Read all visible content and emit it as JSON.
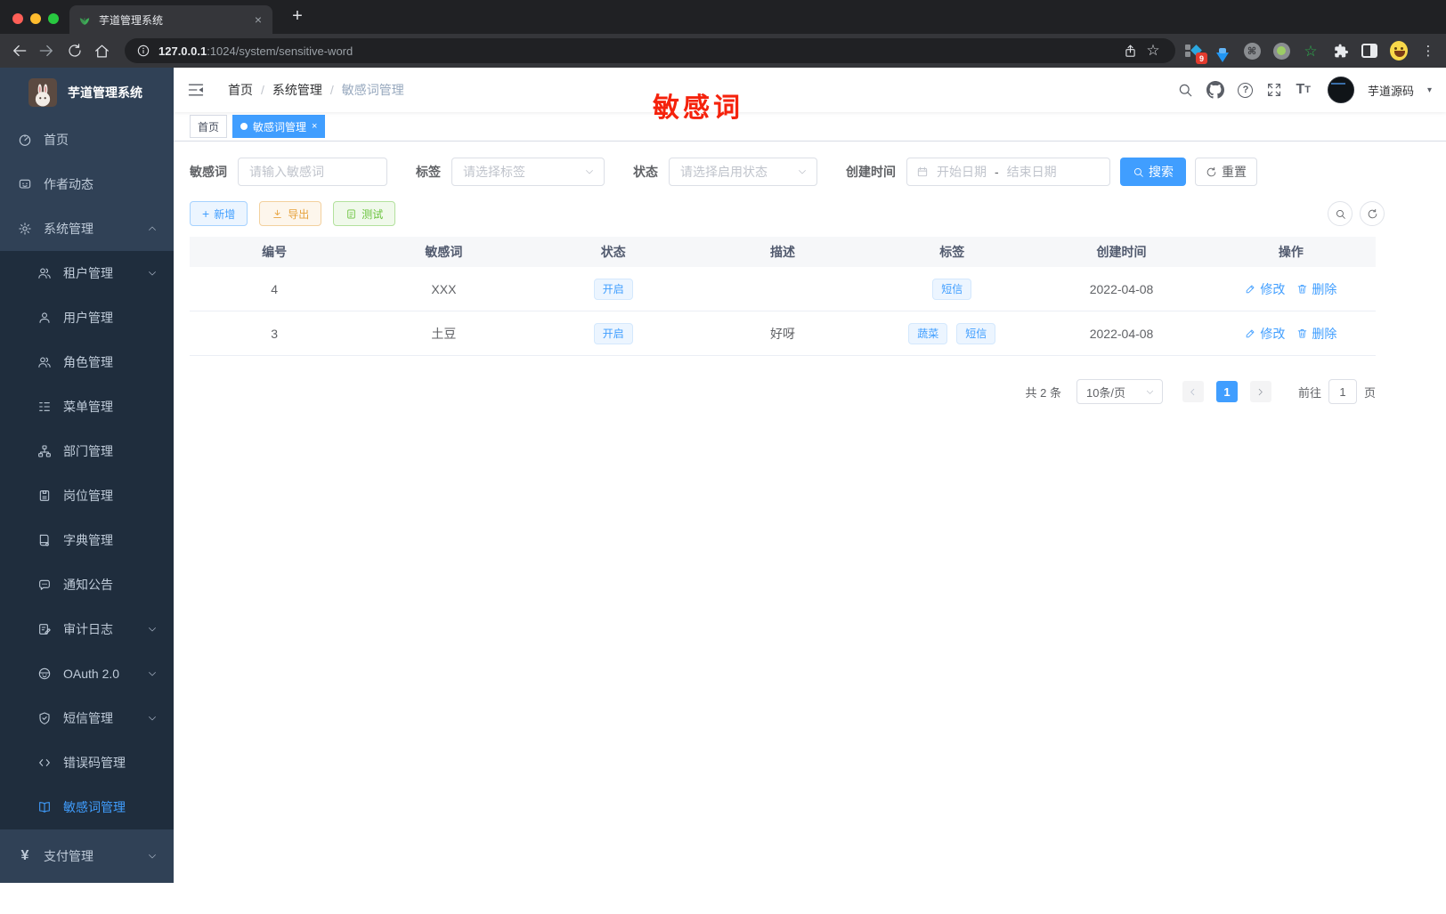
{
  "colors": {
    "accent": "#409eff",
    "annotation_red": "#f5220c",
    "sidebar_bg": "#304156",
    "submenu_bg": "#1f2d3d",
    "export_orange": "#e6a23c",
    "test_green": "#67c23a"
  },
  "icons": {
    "close": "×",
    "plus_tab": "+",
    "dots_menu": "⋮",
    "star": "☆",
    "command": "⌘",
    "green_star": "☆",
    "caret_down": "▾",
    "dot": "●",
    "slash": "/",
    "yen": "¥",
    "plus": "+",
    "font_big": "T",
    "font_small": "T"
  },
  "browser": {
    "tab_title": "芋道管理系统",
    "url_host": "127.0.0.1",
    "url_rest": ":1024/system/sensitive-word",
    "extension_badge": "9"
  },
  "sidebar": {
    "app_title": "芋道管理系统",
    "items": [
      {
        "label": "首页",
        "icon": "dashboard-icon"
      },
      {
        "label": "作者动态",
        "icon": "author-feed-icon"
      },
      {
        "label": "系统管理",
        "icon": "gear-icon"
      },
      {
        "label": "租户管理",
        "icon": "tenant-users-icon"
      },
      {
        "label": "用户管理",
        "icon": "user-icon"
      },
      {
        "label": "角色管理",
        "icon": "role-users-icon"
      },
      {
        "label": "菜单管理",
        "icon": "menu-list-icon"
      },
      {
        "label": "部门管理",
        "icon": "org-tree-icon"
      },
      {
        "label": "岗位管理",
        "icon": "badge-icon"
      },
      {
        "label": "字典管理",
        "icon": "dictionary-icon"
      },
      {
        "label": "通知公告",
        "icon": "notice-bubble-icon"
      },
      {
        "label": "审计日志",
        "icon": "audit-log-icon"
      },
      {
        "label": "OAuth 2.0",
        "icon": "oauth-robot-icon"
      },
      {
        "label": "短信管理",
        "icon": "sms-shield-icon"
      },
      {
        "label": "错误码管理",
        "icon": "error-code-icon"
      },
      {
        "label": "敏感词管理",
        "icon": "sensitive-word-book-icon"
      },
      {
        "label": "支付管理",
        "icon": "pay-yen-icon"
      }
    ]
  },
  "navbar": {
    "breadcrumb": [
      "首页",
      "系统管理",
      "敏感词管理"
    ],
    "username": "芋道源码"
  },
  "annotation": {
    "text": "敏感词"
  },
  "tags_view": [
    {
      "label": "首页"
    },
    {
      "label": "敏感词管理"
    }
  ],
  "filters": {
    "keyword_label": "敏感词",
    "keyword_placeholder": "请输入敏感词",
    "tag_label": "标签",
    "tag_placeholder": "请选择标签",
    "status_label": "状态",
    "status_placeholder": "请选择启用状态",
    "date_label": "创建时间",
    "date_start_placeholder": "开始日期",
    "date_separator": "-",
    "date_end_placeholder": "结束日期",
    "search_label": "搜索",
    "reset_label": "重置"
  },
  "toolbar": {
    "add_label": "新增",
    "export_label": "导出",
    "test_label": "测试"
  },
  "table": {
    "columns": [
      "编号",
      "敏感词",
      "状态",
      "描述",
      "标签",
      "创建时间",
      "操作"
    ],
    "edit_label": "修改",
    "delete_label": "删除",
    "rows": [
      {
        "id": "4",
        "word": "XXX",
        "status": "开启",
        "desc": "",
        "tags": [
          "短信"
        ],
        "created": "2022-04-08"
      },
      {
        "id": "3",
        "word": "土豆",
        "status": "开启",
        "desc": "好呀",
        "tags": [
          "蔬菜",
          "短信"
        ],
        "created": "2022-04-08"
      }
    ]
  },
  "pagination": {
    "total": "共 2 条",
    "size": "10条/页",
    "page": "1",
    "goto_label": "前往",
    "goto_value": "1",
    "unit_label": "页"
  }
}
